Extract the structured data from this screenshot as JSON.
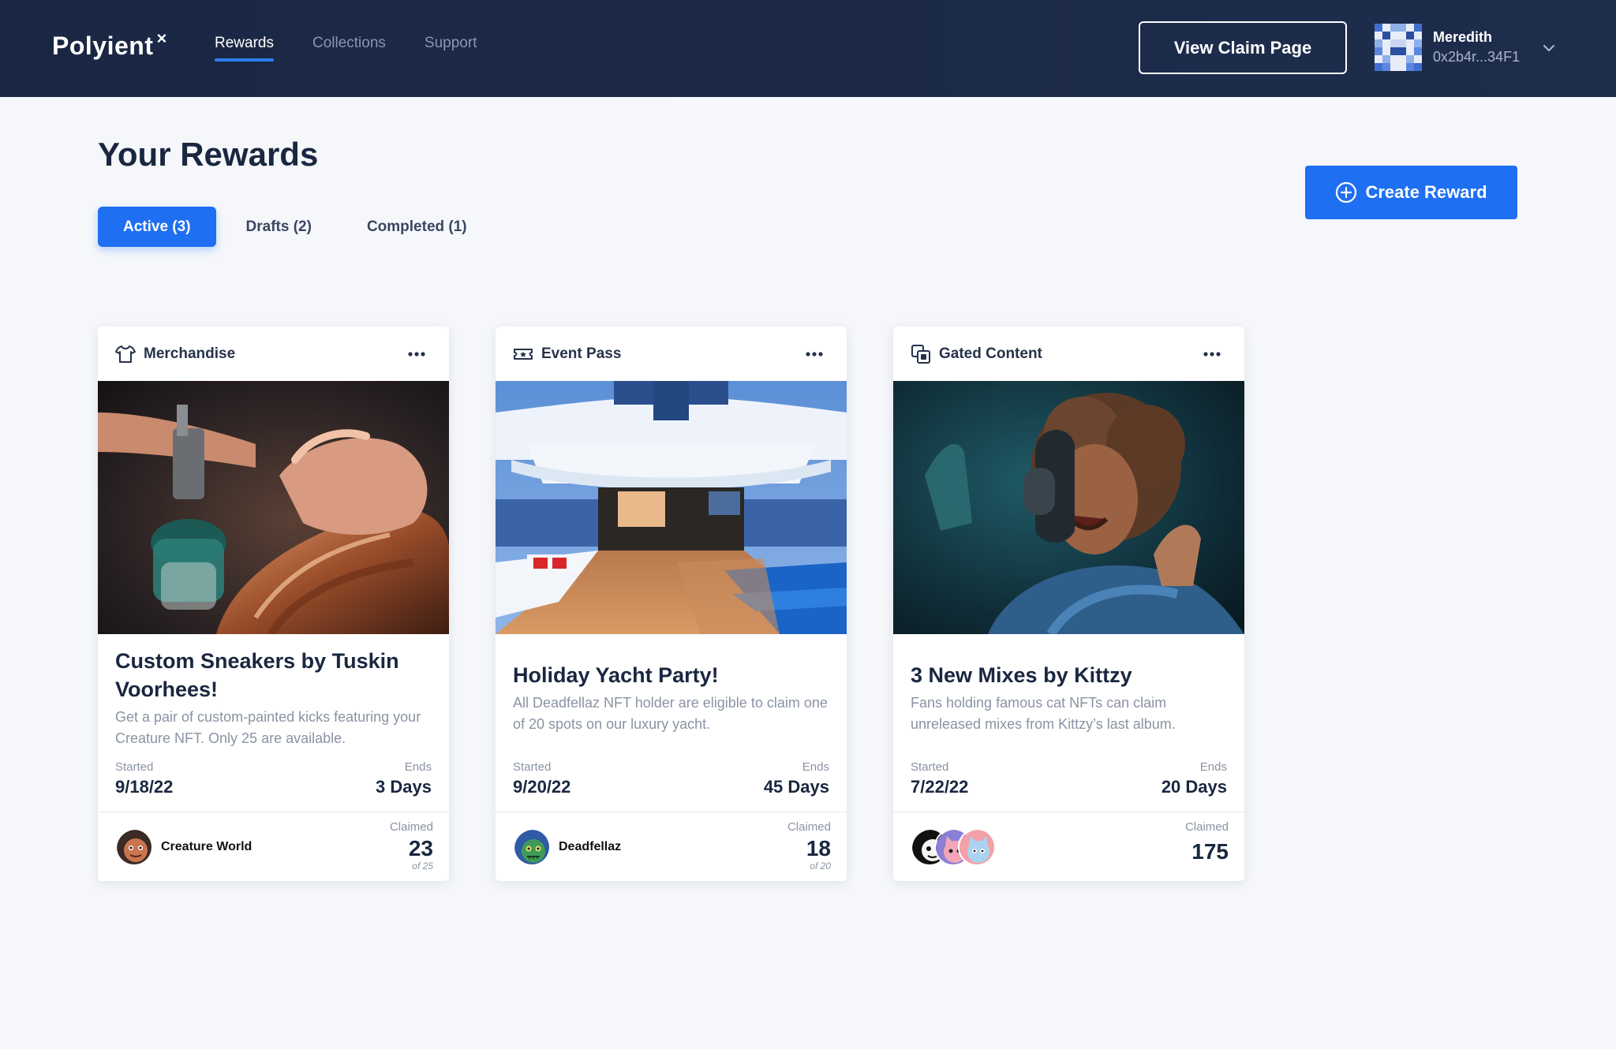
{
  "brand": {
    "name": "Polyient",
    "mark": "×"
  },
  "nav": [
    {
      "label": "Rewards",
      "active": true
    },
    {
      "label": "Collections",
      "active": false
    },
    {
      "label": "Support",
      "active": false
    }
  ],
  "header": {
    "claim_button": "View Claim Page"
  },
  "user": {
    "name": "Meredith",
    "address": "0x2b4r...34F1",
    "avatar_icon": "pixel-avatar"
  },
  "page": {
    "title": "Your Rewards",
    "create_button": "Create Reward",
    "tabs": [
      {
        "label": "Active (3)",
        "active": true
      },
      {
        "label": "Drafts (2)",
        "active": false
      },
      {
        "label": "Completed (1)",
        "active": false
      }
    ]
  },
  "cards": [
    {
      "category": "Merchandise",
      "category_icon": "tshirt-icon",
      "title": "Custom Sneakers by Tuskin Voorhees!",
      "description": "Get a pair of custom-painted kicks featuring your Creature NFT. Only 25 are available.",
      "started_label": "Started",
      "started": "9/18/22",
      "ends_label": "Ends",
      "ends": "3 Days",
      "collection": "Creature World",
      "claimed_label": "Claimed",
      "claimed": "23",
      "claimed_of": "of 25",
      "image": "airbrush-painting-sneaker"
    },
    {
      "category": "Event Pass",
      "category_icon": "ticket-icon",
      "title": "Holiday Yacht Party!",
      "description": "All Deadfellaz NFT holder are eligible to claim one of 20 spots on our luxury yacht.",
      "started_label": "Started",
      "started": "9/20/22",
      "ends_label": "Ends",
      "ends": "45 Days",
      "collection": "Deadfellaz",
      "claimed_label": "Claimed",
      "claimed": "18",
      "claimed_of": "of 20",
      "image": "luxury-yacht-deck"
    },
    {
      "category": "Gated Content",
      "category_icon": "gated-content-icon",
      "title": "3 New Mixes by Kittzy",
      "description": "Fans holding famous cat NFTs can claim unreleased mixes from Kittzy’s last album.",
      "started_label": "Started",
      "started": "7/22/22",
      "ends_label": "Ends",
      "ends": "20 Days",
      "collection": "",
      "claimed_label": "Claimed",
      "claimed": "175",
      "claimed_of": "",
      "image": "singer-in-studio"
    }
  ],
  "colors": {
    "accent": "#1f6ff2",
    "header_bg": "#1c2a48",
    "page_bg": "#f5f7fa"
  }
}
